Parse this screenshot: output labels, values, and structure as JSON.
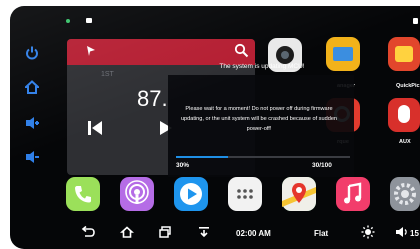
{
  "status_bar": {
    "colors": {
      "dot_green": "#37c46a",
      "dot_white": "#ffffff"
    }
  },
  "left_bar": {
    "icons": [
      "power-icon",
      "home-icon",
      "volume-up-icon",
      "volume-down-icon"
    ],
    "accent": "#2f7fe8"
  },
  "radio": {
    "band": "1ST",
    "frequency": "87.",
    "header_color": "#b51e32",
    "icons": [
      "flag-icon",
      "search-icon",
      "skip-previous-icon",
      "play-next-icon"
    ]
  },
  "update_dialog": {
    "title": "The system is updating MCU!",
    "message": "Please wait for a moment! Do not power off during firmware updating, or the unit system will be crashed because of sudden power-off!",
    "progress_percent": 30,
    "progress_label": "30%",
    "step_label": "30/100",
    "progress_color": "#1f8fe5"
  },
  "apps": {
    "row1": [
      {
        "icon": "camera-icon",
        "label": ""
      },
      {
        "icon": "file-manager-icon",
        "label": "anager"
      },
      {
        "icon": "quickpic-icon",
        "label": "QuickPic"
      }
    ],
    "row2": [
      {
        "icon": "torque-icon",
        "label": "rque"
      },
      {
        "icon": "aux-icon",
        "label": "AUX"
      }
    ]
  },
  "dock": [
    {
      "icon": "phone-icon",
      "color": "#9be05a"
    },
    {
      "icon": "podcast-icon",
      "color": "#b56ce6"
    },
    {
      "icon": "play-icon",
      "color": "#1e95ee"
    },
    {
      "icon": "apps-grid-icon",
      "color": "#f2f2f2"
    },
    {
      "icon": "maps-icon",
      "color": "#3fa35b"
    },
    {
      "icon": "music-icon",
      "color": "#f23d6b"
    },
    {
      "icon": "settings-icon",
      "color": "#8e939b"
    }
  ],
  "nav_bar": {
    "time": "02:00 AM",
    "eq_preset": "Flat",
    "volume": "15",
    "icons": [
      "back-icon",
      "home-icon",
      "recent-apps-icon",
      "download-icon",
      "brightness-icon",
      "volume-icon"
    ]
  }
}
